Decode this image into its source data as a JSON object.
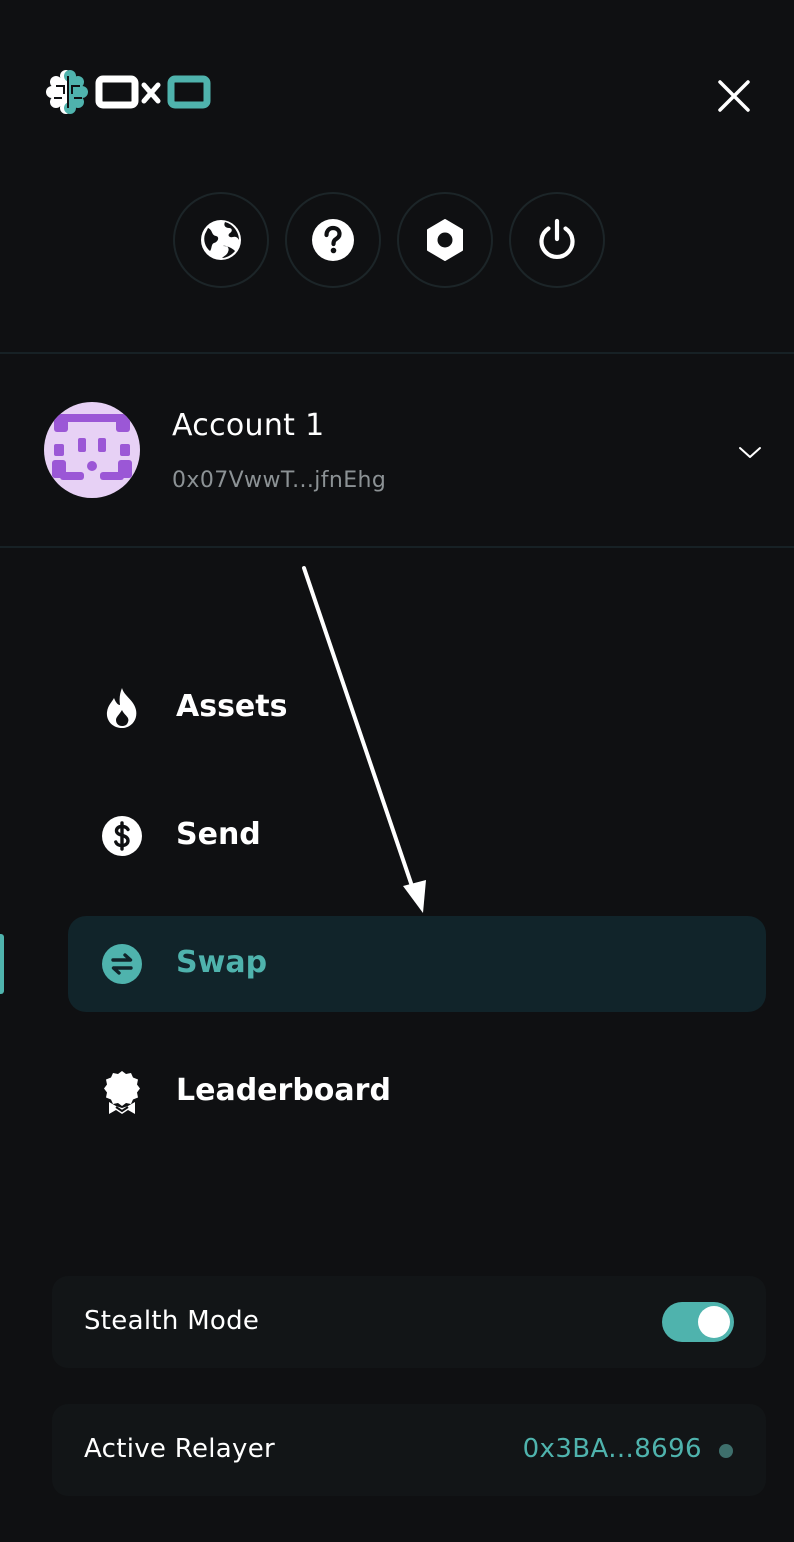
{
  "logo": {
    "text": "OxO",
    "icon": "brain-icon"
  },
  "header": {
    "close_icon": "close-icon"
  },
  "quick_actions": [
    {
      "icon": "globe-icon"
    },
    {
      "icon": "help-icon"
    },
    {
      "icon": "settings-icon"
    },
    {
      "icon": "power-icon"
    }
  ],
  "account": {
    "name": "Account 1",
    "address": "0x07VwwT...jfnEhg",
    "dropdown_icon": "chevron-down-icon"
  },
  "nav": {
    "items": [
      {
        "label": "Assets",
        "icon": "flame-icon",
        "active": false
      },
      {
        "label": "Send",
        "icon": "dollar-icon",
        "active": false
      },
      {
        "label": "Swap",
        "icon": "swap-icon",
        "active": true
      },
      {
        "label": "Leaderboard",
        "icon": "award-icon",
        "active": false
      }
    ]
  },
  "stealth_mode": {
    "label": "Stealth Mode",
    "enabled": true
  },
  "relayer": {
    "label": "Active Relayer",
    "address": "0x3BA...8696"
  },
  "colors": {
    "accent": "#4fb3ad",
    "background": "#0f1012",
    "active_bg": "#11242a",
    "avatar_bg": "#e7d1f5",
    "avatar_fg": "#9b57d6"
  }
}
